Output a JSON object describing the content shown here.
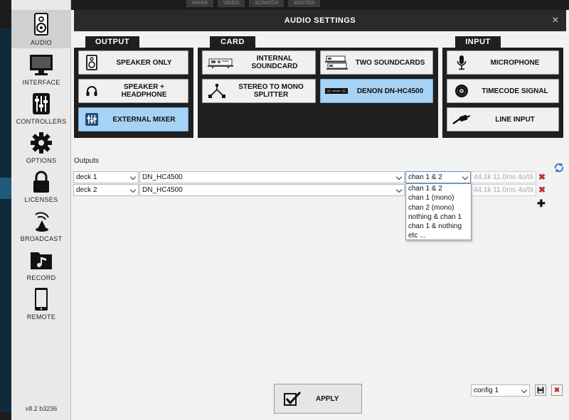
{
  "background": {
    "tabs": [
      "MIXER",
      "VIDEO",
      "SCRATCH",
      "MASTER"
    ]
  },
  "sidebar": {
    "items": [
      {
        "label": "AUDIO",
        "icon": "speaker-icon"
      },
      {
        "label": "INTERFACE",
        "icon": "monitor-icon"
      },
      {
        "label": "CONTROLLERS",
        "icon": "sliders-icon"
      },
      {
        "label": "OPTIONS",
        "icon": "gear-icon"
      },
      {
        "label": "LICENSES",
        "icon": "lock-icon"
      },
      {
        "label": "BROADCAST",
        "icon": "broadcast-icon"
      },
      {
        "label": "RECORD",
        "icon": "music-folder-icon"
      },
      {
        "label": "REMOTE",
        "icon": "tablet-icon"
      }
    ],
    "version": "v8.2 b3236"
  },
  "dialog": {
    "title": "AUDIO SETTINGS",
    "close": "×"
  },
  "groups": {
    "output": {
      "title": "OUTPUT",
      "buttons": [
        "SPEAKER ONLY",
        "SPEAKER + HEADPHONE",
        "EXTERNAL MIXER"
      ],
      "selected": "EXTERNAL MIXER"
    },
    "card": {
      "title": "CARD",
      "buttons": [
        "INTERNAL SOUNDCARD",
        "TWO SOUNDCARDS",
        "STEREO TO MONO SPLITTER",
        "DENON DN-HC4500"
      ],
      "selected": "DENON DN-HC4500"
    },
    "input": {
      "title": "INPUT",
      "buttons": [
        "MICROPHONE",
        "TIMECODE SIGNAL",
        "LINE INPUT"
      ]
    }
  },
  "outputs": {
    "label": "Outputs",
    "rows": [
      {
        "deck": "deck 1",
        "device": "DN_HC4500",
        "channel": "chan 1 & 2",
        "info": "44.1k 11.0ms 4o/0i"
      },
      {
        "deck": "deck 2",
        "device": "DN_HC4500",
        "channel": "",
        "info": "44.1k 11.0ms 4o/0i"
      }
    ],
    "channel_options": [
      "chan 1 & 2",
      "chan 1 (mono)",
      "chan 2 (mono)",
      "nothing & chan 1",
      "chan 1 & nothing",
      "etc ..."
    ]
  },
  "footer": {
    "apply": "APPLY",
    "config": "config 1"
  },
  "colors": {
    "selected": "#a6d2f5",
    "titlebar": "#2a2a2a",
    "delete": "#b33333"
  }
}
